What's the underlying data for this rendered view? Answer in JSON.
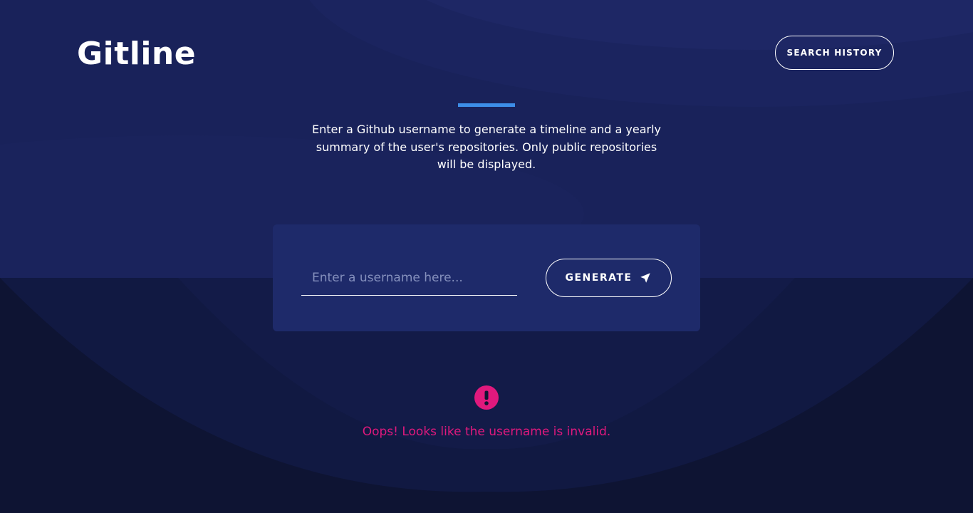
{
  "app": {
    "logo_text": "Gitline"
  },
  "header": {
    "history_label": "SEARCH HISTORY"
  },
  "intro": {
    "text": "Enter a Github username to generate a timeline and a yearly summary of the user's repositories. Only public repositories will be displayed."
  },
  "form": {
    "username_placeholder": "Enter a username here...",
    "username_value": "",
    "generate_label": "GENERATE",
    "generate_icon": "paper-plane-icon"
  },
  "error": {
    "icon": "exclamation-circle-icon",
    "message": "Oops! Looks like the username is invalid."
  },
  "colors": {
    "background_top": "#19225a",
    "background_bottom": "#0e1433",
    "card": "#1e2a6a",
    "accent": "#3d8ee8",
    "error": "#e0197d"
  }
}
